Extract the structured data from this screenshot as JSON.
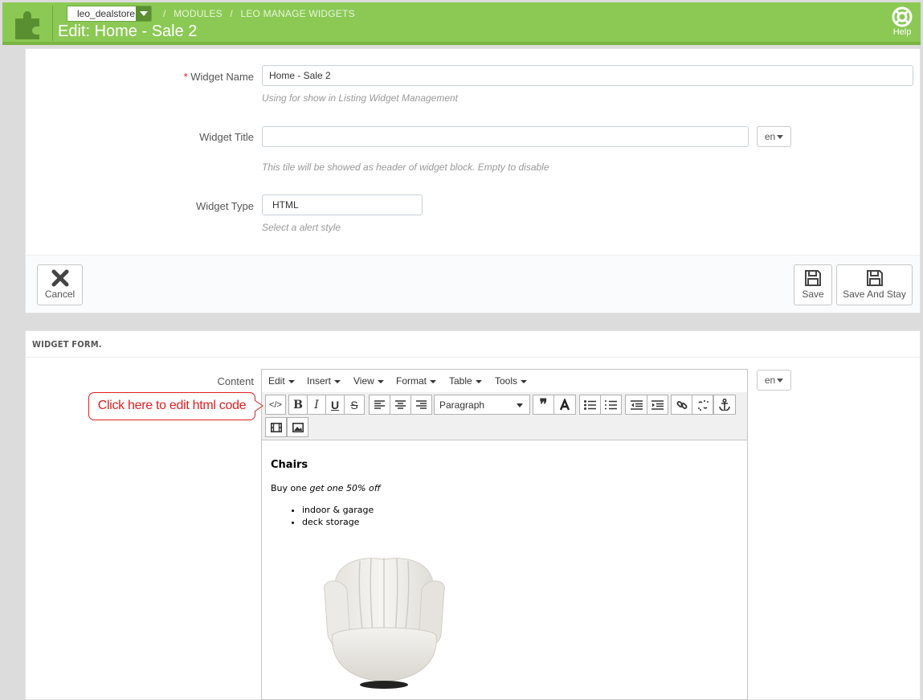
{
  "header": {
    "shop_select": "leo_dealstore",
    "breadcrumb": [
      "/",
      "MODULES",
      "/",
      "LEO MANAGE WIDGETS"
    ],
    "title": "Edit: Home - Sale 2",
    "help_label": "Help",
    "accent": "#8bc954"
  },
  "form": {
    "widget_name": {
      "required_mark": "*",
      "label": "Widget Name",
      "value": "Home - Sale 2",
      "help": "Using for show in Listing Widget Management"
    },
    "widget_title": {
      "label": "Widget Title",
      "value": "",
      "lang": "en",
      "help": "This tile will be showed as header of widget block. Empty to disable"
    },
    "widget_type": {
      "label": "Widget Type",
      "value": "HTML",
      "help": "Select a alert style"
    },
    "buttons": {
      "cancel": "Cancel",
      "save": "Save",
      "save_stay": "Save And Stay"
    }
  },
  "widget_form": {
    "heading": "WIDGET FORM.",
    "content_label": "Content",
    "lang": "en",
    "menus": [
      "Edit",
      "Insert",
      "View",
      "Format",
      "Table",
      "Tools"
    ],
    "toolbar": {
      "source_code": "</>",
      "bold": "B",
      "italic": "I",
      "underline": "U",
      "strikethrough": "S",
      "block_format": "Paragraph"
    },
    "content": {
      "heading": "Chairs",
      "para_plain": "Buy one ",
      "para_italic": "get one 50% off",
      "items": [
        "indoor & garage",
        "deck storage"
      ]
    }
  },
  "callout": "Click here to edit html code"
}
